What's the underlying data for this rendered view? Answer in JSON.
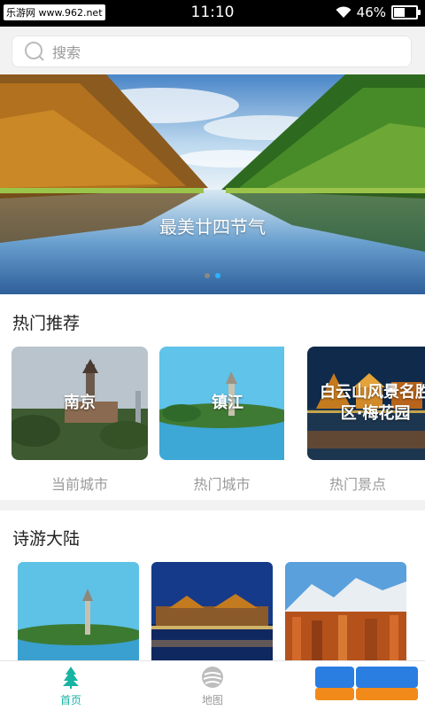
{
  "status_bar": {
    "site_label": "乐游网 www.962.net",
    "time": "11:10",
    "battery": "46%",
    "battery_level": 0.46
  },
  "search": {
    "placeholder": "搜索"
  },
  "banner": {
    "caption": "最美廿四节气",
    "dots_total": 2,
    "active_dot": 2
  },
  "hot": {
    "title": "热门推荐",
    "cards": [
      {
        "name": "南京",
        "label": "当前城市"
      },
      {
        "name": "镇江",
        "label": "热门城市"
      },
      {
        "name": "白云山风景名胜区·梅花园",
        "label": "热门景点"
      }
    ]
  },
  "poem": {
    "title": "诗游大陆"
  },
  "tabbar": {
    "tabs": [
      {
        "label": "首页",
        "icon": "tree-icon",
        "active": true
      },
      {
        "label": "地图",
        "icon": "map-icon",
        "active": false
      }
    ]
  },
  "watermark": {
    "text_top": "962.NET",
    "text_bottom": "乐游网"
  },
  "colors": {
    "accent": "#17b3a3",
    "tab_inactive": "#999999",
    "dot_active": "#2ab4ff"
  }
}
